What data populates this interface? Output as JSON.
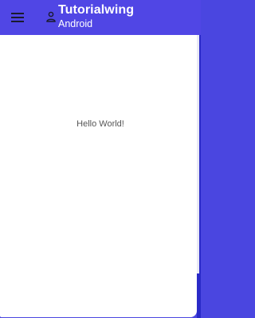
{
  "app_bar": {
    "title": "Tutorialwing",
    "subtitle": "Android",
    "menu_icon": "hamburger-menu-icon",
    "logo_icon": "person-icon",
    "background_color": "#5046e5",
    "text_color": "#ffffff"
  },
  "content": {
    "message": "Hello World!",
    "background_color": "#ffffff"
  }
}
